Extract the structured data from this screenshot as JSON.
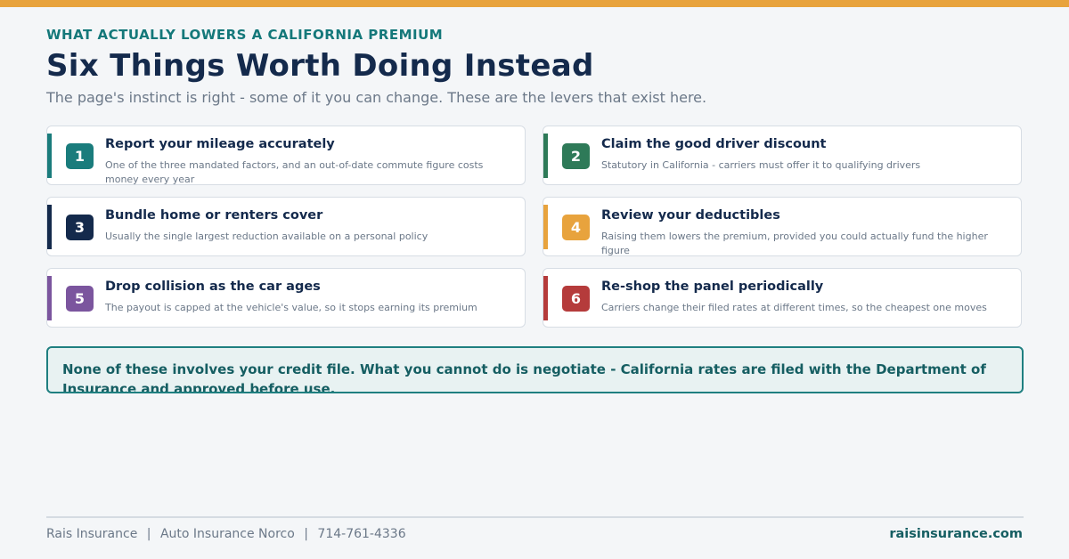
{
  "header": {
    "eyebrow": "WHAT ACTUALLY LOWERS A CALIFORNIA PREMIUM",
    "title": "Six Things Worth Doing Instead",
    "subtitle": "The page's instinct is right - some of it you can change. These are the levers that exist here."
  },
  "levers": [
    {
      "number": "1",
      "title": "Report your mileage accurately",
      "description": "One of the three mandated factors, and an out-of-date commute figure costs money every year",
      "color": "#1a7c7c"
    },
    {
      "number": "2",
      "title": "Claim the good driver discount",
      "description": "Statutory in California - carriers must offer it to qualifying drivers",
      "color": "#2e7a58"
    },
    {
      "number": "3",
      "title": "Bundle home or renters cover",
      "description": "Usually the single largest reduction available on a personal policy",
      "color": "#142a4c"
    },
    {
      "number": "4",
      "title": "Review your deductibles",
      "description": "Raising them lowers the premium, provided you could actually fund the higher figure",
      "color": "#e8a33d"
    },
    {
      "number": "5",
      "title": "Drop collision as the car ages",
      "description": "The payout is capped at the vehicle's value, so it stops earning its premium",
      "color": "#7b559e"
    },
    {
      "number": "6",
      "title": "Re-shop the panel periodically",
      "description": "Carriers change their filed rates at different times, so the cheapest one moves",
      "color": "#b53b3b"
    }
  ],
  "note": {
    "text": "None of these involves your credit file. What you cannot do is negotiate - California rates are filed with the Department of Insurance and approved before use."
  },
  "footer": {
    "company": "Rais Insurance",
    "separator": "|",
    "service": "Auto Insurance Norco",
    "phone": "714-761-4336",
    "website": "raisinsurance.com"
  },
  "colors": {
    "accent_bar": "#e8a33d",
    "teal": "#14787a",
    "navy": "#142a4c",
    "background": "#f4f6f8"
  }
}
